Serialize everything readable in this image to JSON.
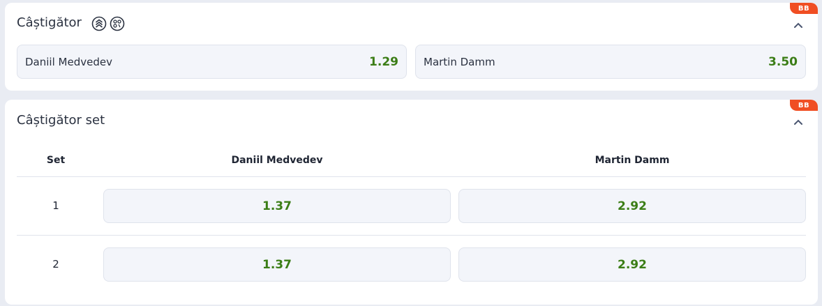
{
  "colors": {
    "odds": "#3b7d16",
    "badge": "#f04e23",
    "panel_bg": "#ffffff",
    "page_bg": "#e9ecf3"
  },
  "winner_market": {
    "title": "Câștigător",
    "badge": "BB",
    "icons": [
      "bet-builder-icon",
      "scoreline-icon"
    ],
    "outcomes": [
      {
        "name": "Daniil Medvedev",
        "odds": "1.29"
      },
      {
        "name": "Martin Damm",
        "odds": "3.50"
      }
    ]
  },
  "set_winner_market": {
    "title": "Câștigător set",
    "badge": "BB",
    "headers": {
      "set": "Set",
      "player1": "Daniil Medvedev",
      "player2": "Martin Damm"
    },
    "rows": [
      {
        "set": "1",
        "player1_odds": "1.37",
        "player2_odds": "2.92"
      },
      {
        "set": "2",
        "player1_odds": "1.37",
        "player2_odds": "2.92"
      }
    ]
  }
}
